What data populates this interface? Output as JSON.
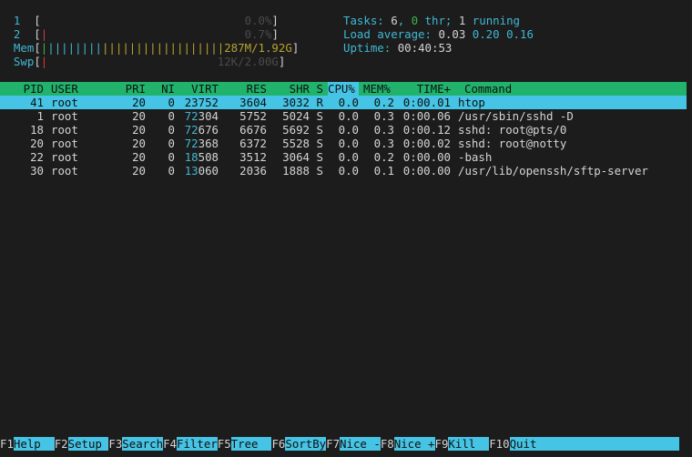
{
  "meters": {
    "cpu1": {
      "label": "1",
      "value": "0.0%"
    },
    "cpu2": {
      "label": "2",
      "value": "0.7%"
    },
    "mem": {
      "label": "Mem",
      "value": "287M/1.92G"
    },
    "swp": {
      "label": "Swp",
      "value": "12K/2.00G"
    }
  },
  "summary": {
    "tasks_label": "Tasks: ",
    "tasks": "6",
    "threads": "0",
    "thr_label": " thr; ",
    "running": "1",
    "running_label": " running",
    "load_label": "Load average: ",
    "load1": "0.03",
    "load5": "0.20",
    "load15": "0.16",
    "uptime_label": "Uptime: ",
    "uptime": "00:40:53"
  },
  "columns": {
    "pid": "PID",
    "user": "USER",
    "pri": "PRI",
    "ni": "NI",
    "virt": "VIRT",
    "res": "RES",
    "shr": "SHR",
    "s": "S",
    "cpu": "CPU%",
    "mem": "MEM%",
    "time": "TIME+",
    "command": "Command"
  },
  "processes": [
    {
      "pid": "41",
      "user": "root",
      "pri": "20",
      "ni": "0",
      "virt_a": "23",
      "virt_b": "752",
      "res": "3604",
      "shr": "3032",
      "s": "R",
      "cpu": "0.0",
      "mem": "0.2",
      "time": "0:00.01",
      "command": "htop"
    },
    {
      "pid": "1",
      "user": "root",
      "pri": "20",
      "ni": "0",
      "virt_a": "72",
      "virt_b": "304",
      "res": "5752",
      "shr": "5024",
      "s": "S",
      "cpu": "0.0",
      "mem": "0.3",
      "time": "0:00.06",
      "command": "/usr/sbin/sshd -D"
    },
    {
      "pid": "18",
      "user": "root",
      "pri": "20",
      "ni": "0",
      "virt_a": "72",
      "virt_b": "676",
      "res": "6676",
      "shr": "5692",
      "s": "S",
      "cpu": "0.0",
      "mem": "0.3",
      "time": "0:00.12",
      "command": "sshd: root@pts/0"
    },
    {
      "pid": "20",
      "user": "root",
      "pri": "20",
      "ni": "0",
      "virt_a": "72",
      "virt_b": "368",
      "res": "6372",
      "shr": "5528",
      "s": "S",
      "cpu": "0.0",
      "mem": "0.3",
      "time": "0:00.02",
      "command": "sshd: root@notty"
    },
    {
      "pid": "22",
      "user": "root",
      "pri": "20",
      "ni": "0",
      "virt_a": "18",
      "virt_b": "508",
      "res": "3512",
      "shr": "3064",
      "s": "S",
      "cpu": "0.0",
      "mem": "0.2",
      "time": "0:00.00",
      "command": "-bash"
    },
    {
      "pid": "30",
      "user": "root",
      "pri": "20",
      "ni": "0",
      "virt_a": "13",
      "virt_b": "060",
      "res": "2036",
      "shr": "1888",
      "s": "S",
      "cpu": "0.0",
      "mem": "0.1",
      "time": "0:00.00",
      "command": "/usr/lib/openssh/sftp-server"
    }
  ],
  "function_keys": [
    {
      "key": "F1",
      "label": "Help  "
    },
    {
      "key": "F2",
      "label": "Setup "
    },
    {
      "key": "F3",
      "label": "Search"
    },
    {
      "key": "F4",
      "label": "Filter"
    },
    {
      "key": "F5",
      "label": "Tree  "
    },
    {
      "key": "F6",
      "label": "SortBy"
    },
    {
      "key": "F7",
      "label": "Nice -"
    },
    {
      "key": "F8",
      "label": "Nice +"
    },
    {
      "key": "F9",
      "label": "Kill  "
    },
    {
      "key": "F10",
      "label": "Quit                     "
    }
  ]
}
